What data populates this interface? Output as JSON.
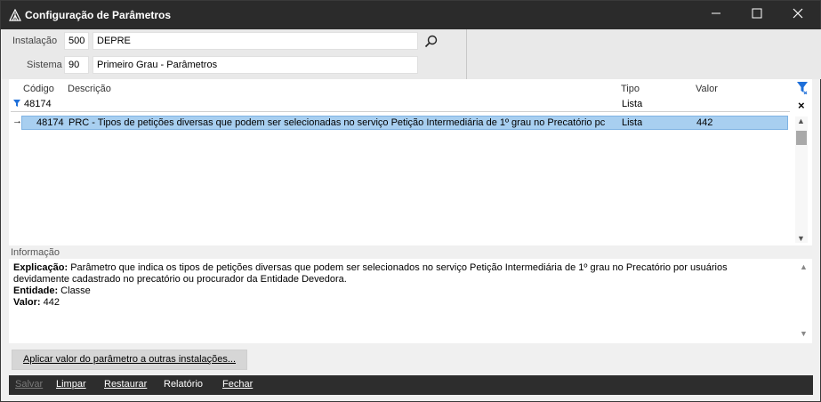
{
  "window": {
    "title": "Configuração de Parâmetros",
    "controls": {
      "minimize": "—",
      "maximize": "☐",
      "close": "✕"
    }
  },
  "fields": {
    "instalacao_label": "Instalação",
    "instalacao_code": "500",
    "instalacao_name": "DEPRE",
    "sistema_label": "Sistema",
    "sistema_code": "90",
    "sistema_name": "Primeiro Grau - Parâmetros"
  },
  "grid": {
    "columns": {
      "codigo": "Código",
      "descricao": "Descrição",
      "tipo": "Tipo",
      "valor": "Valor"
    },
    "filter": {
      "codigo": "48174",
      "tipo": "Lista"
    },
    "rows": [
      {
        "codigo": "48174",
        "descricao": "PRC - Tipos de petições diversas que podem ser selecionadas no serviço Petição Intermediária de 1º grau no Precatório pc",
        "tipo": "Lista",
        "valor": "442"
      }
    ]
  },
  "info": {
    "title": "Informação",
    "explicacao_label": "Explicação:",
    "explicacao_text": " Parâmetro que indica os tipos de petições diversas que podem ser selecionados no serviço Petição Intermediária de 1º grau no Precatório por usuários devidamente cadastrado no precatório ou procurador da Entidade Devedora.",
    "entidade_label": "Entidade:",
    "entidade_text": " Classe",
    "valor_label": "Valor:",
    "valor_text": " 442"
  },
  "apply_button": "Aplicar valor do parâmetro a outras instalações...",
  "actions": {
    "salvar": "Salvar",
    "limpar": "Limpar",
    "restaurar": "Restaurar",
    "relatorio": "Relatório",
    "fechar": "Fechar"
  },
  "colors": {
    "titlebar": "#2b2b2b",
    "selection": "#a8cff0",
    "filter_icon": "#1e6fd9"
  }
}
